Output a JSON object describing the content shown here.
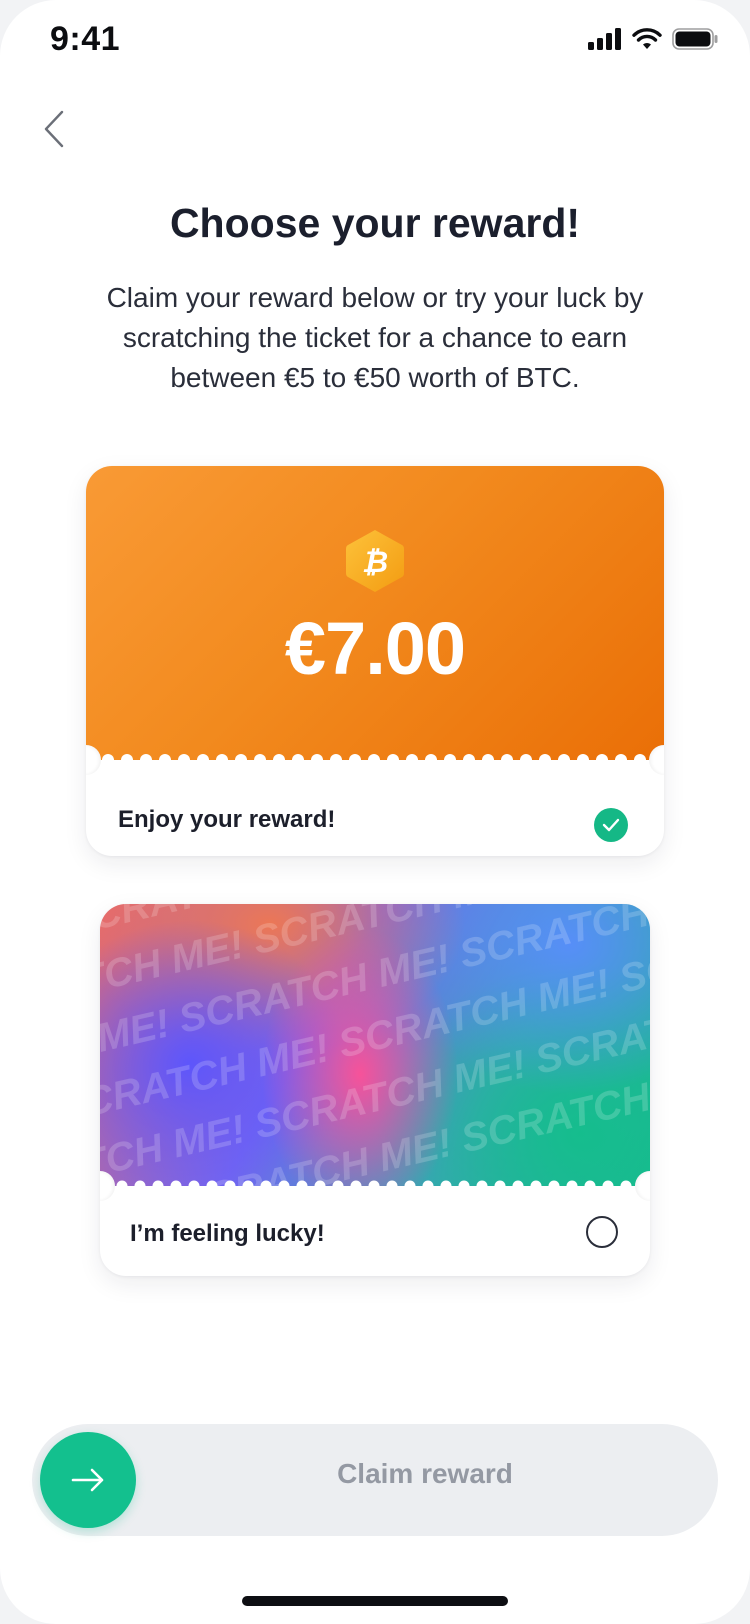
{
  "status_bar": {
    "time": "9:41"
  },
  "header": {
    "title": "Choose your reward!",
    "subtitle": "Claim your reward below or try your luck by scratching the ticket for a chance to earn between €5 to €50 worth of BTC."
  },
  "reward_card": {
    "amount": "€7.00",
    "label": "Enjoy your reward!",
    "selected": true,
    "icon": "bitcoin-icon"
  },
  "lucky_card": {
    "label": "I’m feeling lucky!",
    "selected": false,
    "scratch_text": "SCRATCH ME!"
  },
  "claim": {
    "label": "Claim reward",
    "icon": "arrow-right-icon"
  },
  "colors": {
    "accent_green": "#13c08e",
    "btc_orange": "#f28a1e"
  }
}
